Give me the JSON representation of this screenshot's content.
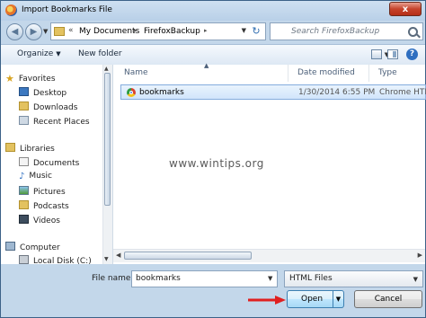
{
  "window": {
    "title": "Import Bookmarks File",
    "close_glyph": "x"
  },
  "address": {
    "chevron": "«",
    "segments": [
      "My Documents",
      "FirefoxBackup"
    ],
    "separator": "▸",
    "refresh_glyph": "↻"
  },
  "search": {
    "placeholder": "Search FirefoxBackup"
  },
  "toolbar": {
    "organize_label": "Organize",
    "new_folder_label": "New folder",
    "help_glyph": "?"
  },
  "nav": {
    "favorites": {
      "label": "Favorites",
      "items": [
        "Desktop",
        "Downloads",
        "Recent Places"
      ]
    },
    "libraries": {
      "label": "Libraries",
      "items": [
        "Documents",
        "Music",
        "Pictures",
        "Podcasts",
        "Videos"
      ]
    },
    "computer": {
      "label": "Computer",
      "items": [
        "Local Disk (C:)"
      ]
    }
  },
  "columns": {
    "name": "Name",
    "date": "Date modified",
    "type": "Type"
  },
  "files": [
    {
      "name": "bookmarks",
      "date": "1/30/2014 6:55 PM",
      "type": "Chrome HTM",
      "selected": true,
      "icon": "chrome-icon"
    }
  ],
  "watermark": "www.wintips.org",
  "bottom": {
    "file_name_label": "File name:",
    "file_name_value": "bookmarks",
    "filter_value": "HTML Files",
    "open_label": "Open",
    "cancel_label": "Cancel"
  },
  "colors": {
    "accent": "#3c7fb1",
    "frame": "#c3d7ea",
    "selection": "#d1e5fb",
    "arrow": "#e02020"
  }
}
